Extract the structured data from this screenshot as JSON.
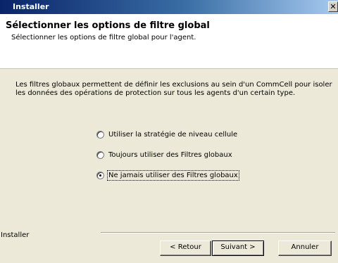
{
  "window": {
    "title": "Installer",
    "close_label": "✕"
  },
  "header": {
    "title": "Sélectionner les options de filtre global",
    "subtitle": "Sélectionner les options de filtre global pour l'agent."
  },
  "body": {
    "description": "Les filtres globaux permettent de définir les exclusions au sein d'un CommCell pour isoler les données des opérations de protection sur tous les agents d'un certain type.",
    "options": [
      {
        "label": "Utiliser la stratégie de niveau cellule",
        "checked": false
      },
      {
        "label": "Toujours utiliser des Filtres globaux",
        "checked": false
      },
      {
        "label": "Ne jamais utiliser des Filtres globaux",
        "checked": true
      }
    ]
  },
  "footer": {
    "label": "Installer",
    "back_label": "< Retour",
    "next_label": "Suivant >",
    "cancel_label": "Annuler"
  }
}
